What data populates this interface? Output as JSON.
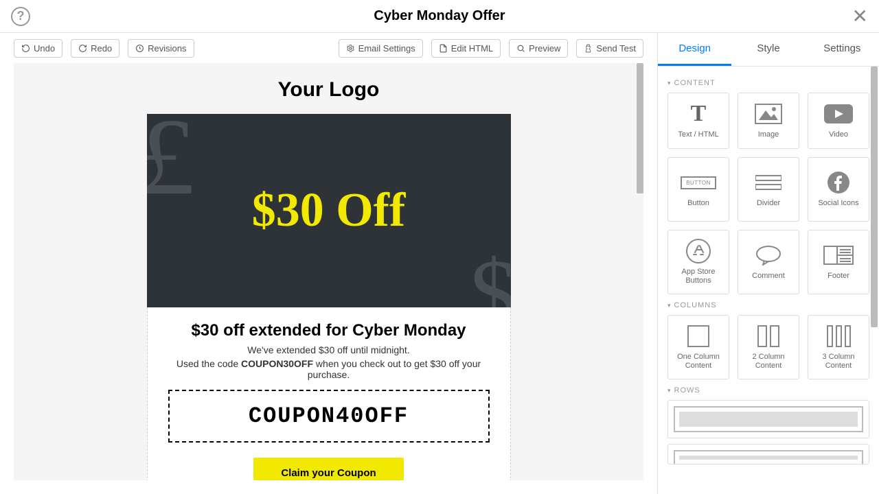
{
  "header": {
    "title": "Cyber Monday Offer"
  },
  "toolbar": {
    "undo": "Undo",
    "redo": "Redo",
    "revisions": "Revisions",
    "email_settings": "Email Settings",
    "edit_html": "Edit HTML",
    "preview": "Preview",
    "send_test": "Send Test"
  },
  "email": {
    "logo": "Your Logo",
    "hero_text": "$30 Off",
    "headline": "$30 off extended for Cyber Monday",
    "sub1": "We've extended $30 off until midnight.",
    "sub2_pre": "Used the code ",
    "sub2_code": "COUPON30OFF",
    "sub2_post": " when you check out to get $30 off your purchase.",
    "coupon": "COUPON40OFF",
    "cta": "Claim your Coupon"
  },
  "sidebar": {
    "tabs": {
      "design": "Design",
      "style": "Style",
      "settings": "Settings"
    },
    "sections": {
      "content": "CONTENT",
      "columns": "COLUMNS",
      "rows": "ROWS"
    },
    "widgets": {
      "text": "Text / HTML",
      "image": "Image",
      "video": "Video",
      "button": "Button",
      "divider": "Divider",
      "social": "Social Icons",
      "appstore": "App Store Buttons",
      "comment": "Comment",
      "footer": "Footer",
      "col1": "One Column Content",
      "col2": "2 Column Content",
      "col3": "3 Column Content"
    },
    "button_badge": "BUTTON"
  }
}
